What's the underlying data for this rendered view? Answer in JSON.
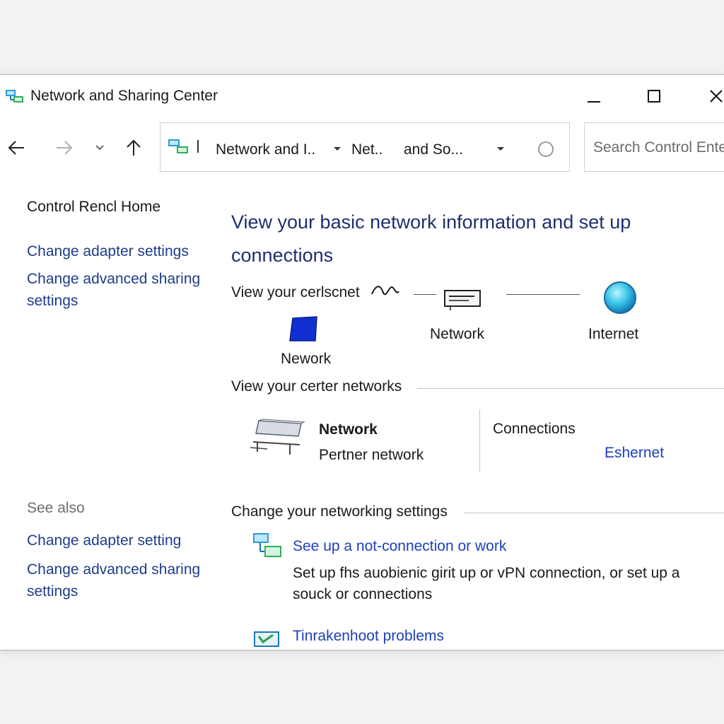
{
  "window": {
    "title": "Network and Sharing Center"
  },
  "address": {
    "crumbs": [
      "Network and I..",
      "Net..",
      "and So..."
    ]
  },
  "search": {
    "placeholder": "Search Control Ente"
  },
  "left": {
    "home": "Control Rencl Home",
    "links": [
      "Change adapter settings",
      "Change advanced sharing",
      "settings"
    ],
    "see_also": "See also",
    "see_also_links": [
      "Change adapter setting",
      "Change advanced sharing",
      "settings"
    ]
  },
  "main": {
    "heading_line1": "View your basic network information and set up",
    "heading_line2": "connections",
    "map_label": "View your cerlscnet",
    "map_nodes": [
      "Nework",
      "Network",
      "Internet"
    ],
    "active_label": "View your certer networks",
    "active_network": {
      "name": "Network",
      "type": "Pertner network",
      "connections_label": "Connections",
      "connection": "Eshernet"
    },
    "change_label": "Change your networking settings",
    "setup_link": "See up a not-connection or work",
    "setup_desc": "Set up fhs auobienic girit up or vPN connection, or set up a souck or connections",
    "troubleshoot_link": "Tinrakenhoot problems"
  },
  "colors": {
    "heading": "#1f2f70",
    "link": "#1c3fbd",
    "left_link": "#1f3c88"
  },
  "icons": [
    "network-app-icon",
    "minimize-icon",
    "maximize-icon",
    "close-icon",
    "back-arrow-icon",
    "forward-arrow-icon",
    "dropdown-chevron-icon",
    "up-arrow-icon",
    "refresh-icon",
    "computer-icon",
    "router-icon",
    "globe-icon",
    "network-adapter-icon",
    "setup-connection-icon",
    "troubleshoot-icon"
  ]
}
